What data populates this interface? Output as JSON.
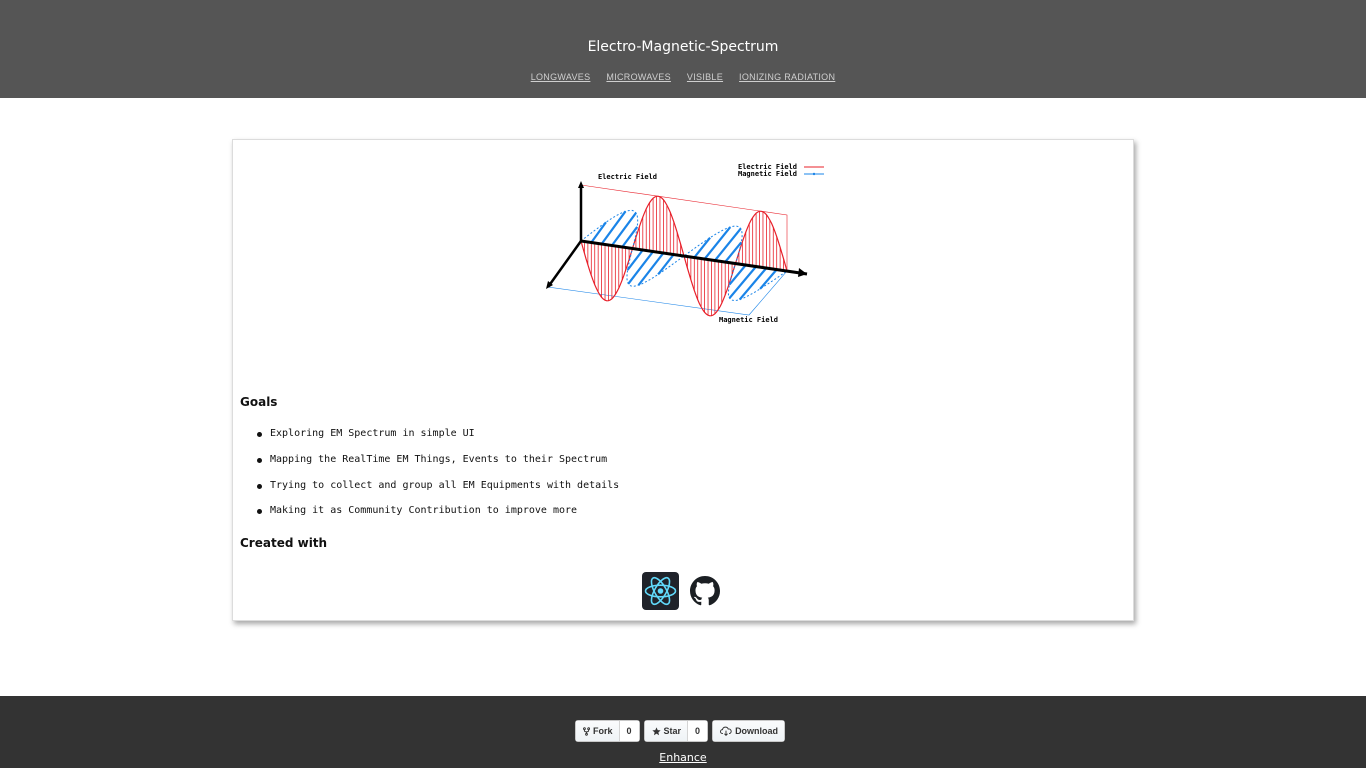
{
  "header": {
    "title": "Electro-Magnetic-Spectrum",
    "nav": [
      "LONGWAVES",
      "MICROWAVES",
      "VISIBLE",
      "IONIZING RADIATION"
    ]
  },
  "diagram": {
    "labels": {
      "electric_field": "Electric Field",
      "magnetic_field": "Magnetic Field"
    },
    "legend": {
      "electric": "Electric Field",
      "magnetic": "Magnetic Field"
    },
    "colors": {
      "electric": "#e8202a",
      "magnetic": "#1a84e8",
      "axis": "#000000"
    }
  },
  "goals": {
    "heading": "Goals",
    "items": [
      "Exploring EM Spectrum in simple UI",
      "Mapping the RealTime EM Things, Events to their Spectrum",
      "Trying to collect and group all EM Equipments with details",
      "Making it as Community Contribution to improve more"
    ]
  },
  "created_with": {
    "heading": "Created with",
    "logos": [
      "react-icon",
      "github-icon"
    ]
  },
  "footer": {
    "fork_label": "Fork",
    "fork_count": "0",
    "star_label": "Star",
    "star_count": "0",
    "download_label": "Download",
    "enhance_label": "Enhance"
  }
}
